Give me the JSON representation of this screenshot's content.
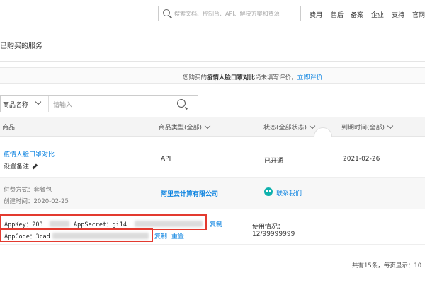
{
  "search": {
    "placeholder": "搜索文档、控制台、API、解决方案和资源"
  },
  "nav": [
    "费用",
    "售后",
    "备案",
    "企业",
    "支持",
    "官网"
  ],
  "page_title": "已购买的服务",
  "notice": {
    "prefix": "您购买的",
    "product": "疫情人脸口罩对比",
    "middle": "尚未填写评价，",
    "link": "立即评价"
  },
  "filter": {
    "select_label": "商品名称",
    "input_placeholder": "请输入"
  },
  "table_headers": {
    "product": "商品",
    "type": "商品类型(全部)",
    "status": "状态(全部状态)",
    "expiry": "到期时间(全部)"
  },
  "row": {
    "name": "疫情人脸口罩对比",
    "note": "设置备注",
    "type": "API",
    "status": "已开通",
    "expiry": "2021-02-26",
    "pay_method": "付费方式：套餐包",
    "created": "创建时间：2020-02-25",
    "vendor": "阿里云计算有限公司",
    "contact": "联系我们",
    "appkey_label": "AppKey：203",
    "appsecret_label": "AppSecret：gi14",
    "appcode_label": "AppCode：3cad",
    "copy1": "复制",
    "copy2": "复制",
    "reset": "重置",
    "usage_label": "使用情况：",
    "usage_value": "12/99999999"
  },
  "footer": {
    "summary": "共有15条，每页显示：10"
  },
  "colors": {
    "accent": "#0a82e0",
    "highlight_box": "#e33a2f",
    "chat_icon": "#0fb1ad"
  },
  "icons": {
    "search": "search-icon",
    "filter_search": "magnifier-icon",
    "edit": "pencil-icon",
    "contact": "chat-bubble-icon",
    "dropdown": "chevron-down-icon"
  }
}
